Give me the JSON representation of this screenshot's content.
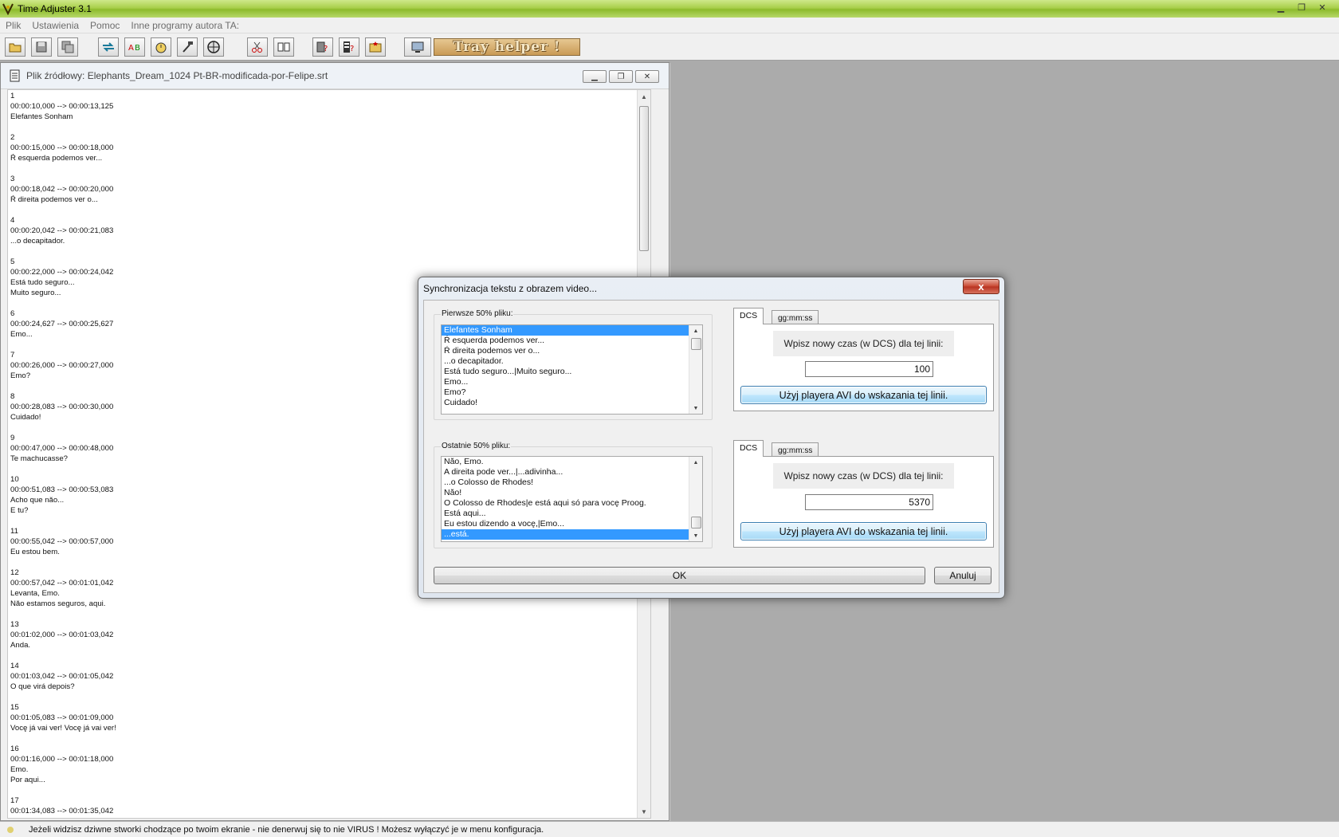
{
  "window": {
    "title": "Time Adjuster 3.1"
  },
  "menu": [
    "Plik",
    "Ustawienia",
    "Pomoc",
    "Inne programy autora TA:"
  ],
  "toolbar": {
    "buttons": [
      "open-icon",
      "save-icon",
      "save-as-icon",
      "shift-time-icon",
      "text-convert-icon",
      "timer-icon",
      "hammer-icon",
      "globe-icon",
      "cut-icon",
      "join-icon",
      "help-book-icon",
      "video-help-icon",
      "star-folder-icon",
      "monitor-icon"
    ],
    "tray_helper": "Tray helper !"
  },
  "source_window": {
    "title": "Plik źródłowy: Elephants_Dream_1024 Pt-BR-modificada-por-Felipe.srt",
    "entries": [
      {
        "num": "1",
        "time": "00:00:10,000 --> 00:00:13,125",
        "lines": [
          "Elefantes Sonham"
        ]
      },
      {
        "num": "2",
        "time": "00:00:15,000 --> 00:00:18,000",
        "lines": [
          "Ŕ esquerda podemos ver..."
        ]
      },
      {
        "num": "3",
        "time": "00:00:18,042 --> 00:00:20,000",
        "lines": [
          "Ŕ direita podemos ver o..."
        ]
      },
      {
        "num": "4",
        "time": "00:00:20,042 --> 00:00:21,083",
        "lines": [
          "...o decapitador."
        ]
      },
      {
        "num": "5",
        "time": "00:00:22,000 --> 00:00:24,042",
        "lines": [
          "Está tudo seguro...",
          "Muito seguro..."
        ]
      },
      {
        "num": "6",
        "time": "00:00:24,627 --> 00:00:25,627",
        "lines": [
          "Emo..."
        ]
      },
      {
        "num": "7",
        "time": "00:00:26,000 --> 00:00:27,000",
        "lines": [
          "Emo?"
        ]
      },
      {
        "num": "8",
        "time": "00:00:28,083 --> 00:00:30,000",
        "lines": [
          "Cuidado!"
        ]
      },
      {
        "num": "9",
        "time": "00:00:47,000 --> 00:00:48,000",
        "lines": [
          "Te machucasse?"
        ]
      },
      {
        "num": "10",
        "time": "00:00:51,083 --> 00:00:53,083",
        "lines": [
          "Acho que năo...",
          "E tu?"
        ]
      },
      {
        "num": "11",
        "time": "00:00:55,042 --> 00:00:57,000",
        "lines": [
          "Eu estou bem."
        ]
      },
      {
        "num": "12",
        "time": "00:00:57,042 --> 00:01:01,042",
        "lines": [
          "Levanta, Emo.",
          "Năo estamos seguros, aqui."
        ]
      },
      {
        "num": "13",
        "time": "00:01:02,000 --> 00:01:03,042",
        "lines": [
          "Anda."
        ]
      },
      {
        "num": "14",
        "time": "00:01:03,042 --> 00:01:05,042",
        "lines": [
          "O que virá depois?"
        ]
      },
      {
        "num": "15",
        "time": "00:01:05,083 --> 00:01:09,000",
        "lines": [
          "Vocę já vai ver! Vocę já vai ver!"
        ]
      },
      {
        "num": "16",
        "time": "00:01:16,000 --> 00:01:18,000",
        "lines": [
          "Emo.",
          "Por aqui..."
        ]
      },
      {
        "num": "17",
        "time": "00:01:34,083 --> 00:01:35,042",
        "lines": []
      }
    ]
  },
  "dialog": {
    "title": "Synchronizacja tekstu z obrazem video...",
    "close": "x",
    "first_half": {
      "label": "Pierwsze 50% pliku:",
      "items": [
        "Elefantes Sonham",
        "Ŕ esquerda podemos ver...",
        "Ŕ direita podemos ver o...",
        "...o decapitador.",
        "Está tudo seguro...|Muito seguro...",
        "Emo...",
        "Emo?",
        "Cuidado!"
      ],
      "selected": 0,
      "tab_active": "DCS",
      "tab_inactive": "gg:mm:ss",
      "prompt": "Wpisz nowy czas (w DCS) dla tej linii:",
      "value": "100",
      "avi_button": "Użyj playera AVI do wskazania tej linii."
    },
    "last_half": {
      "label": "Ostatnie 50% pliku:",
      "items": [
        "Năo, Emo.",
        "A direita pode ver...|...adivinha...",
        "...o Colosso de Rhodes!",
        "Năo!",
        "O Colosso de Rhodes|e está aqui só para vocę Proog.",
        "Está aqui...",
        "Eu estou dizendo a vocę,|Emo...",
        "...está."
      ],
      "selected": 7,
      "tab_active": "DCS",
      "tab_inactive": "gg:mm:ss",
      "prompt": "Wpisz nowy czas (w DCS) dla tej linii:",
      "value": "5370",
      "avi_button": "Użyj playera AVI do wskazania tej linii."
    },
    "ok": "OK",
    "cancel": "Anuluj"
  },
  "status": "Jeżeli widzisz dziwne stworki chodzące po twoim ekranie - nie denerwuj się to nie VIRUS ! Możesz wyłączyć je w menu konfiguracja."
}
